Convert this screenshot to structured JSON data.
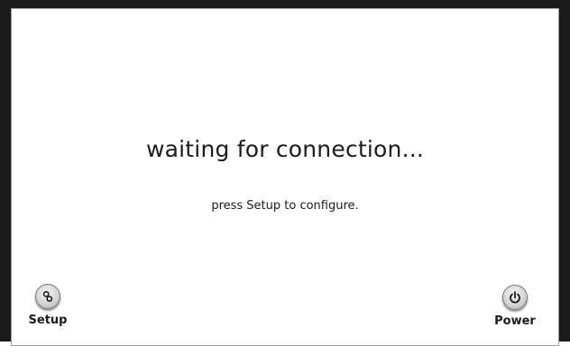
{
  "status": {
    "title": "waiting for connection...",
    "hint": "press Setup to configure."
  },
  "buttons": {
    "setup": {
      "label": "Setup",
      "icon": "setup-icon"
    },
    "power": {
      "label": "Power",
      "icon": "power-icon"
    }
  }
}
